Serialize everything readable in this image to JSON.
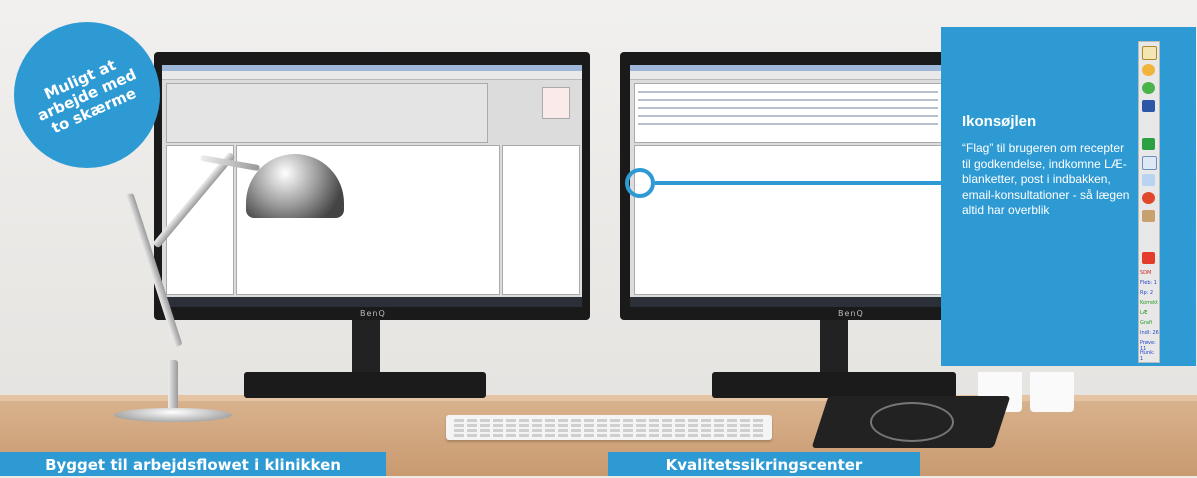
{
  "badge": {
    "text": "Muligt at\narbejde med\nto skærme"
  },
  "callout": {
    "title": "Ikonsøjlen",
    "text": "“Flag” til brugeren om recepter til godkendelse, indkomne LÆ-blanketter, post i indbakken, email-konsultationer - så lægen altid har overblik"
  },
  "labels": {
    "left": "Bygget til arbejdsflowet i klinikken",
    "right": "Kvalitetssikringscenter"
  },
  "monitors": {
    "left_brand": "BenQ",
    "right_brand": "BenQ"
  },
  "iconbar_texts": [
    "SDM",
    "Fleb: 1",
    "Rp: 2",
    "Korrekt",
    "LÆ",
    "Grafi",
    "Indl: 26",
    "Prøve: 11",
    "Hunk: 1"
  ],
  "colors": {
    "accent": "#2e9ad4",
    "desk": "#d2a77f",
    "wall": "#efeeec"
  }
}
